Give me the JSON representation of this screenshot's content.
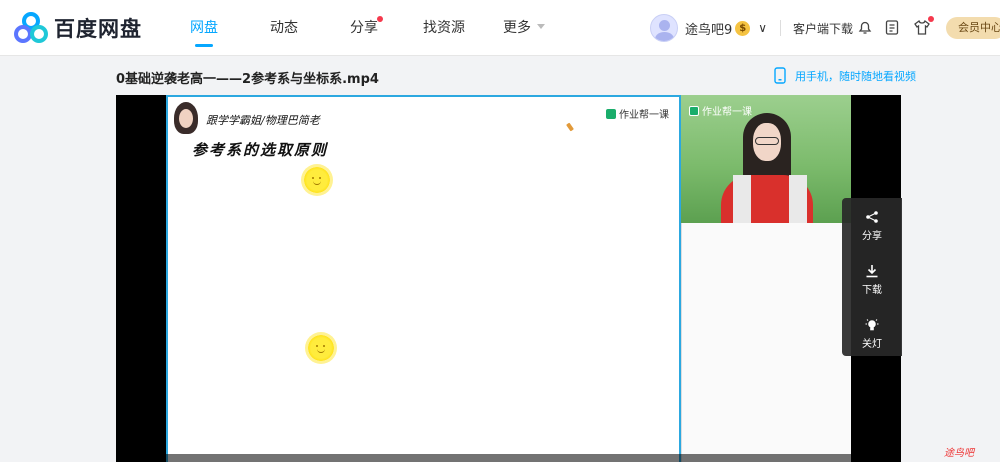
{
  "header": {
    "brand": "百度网盘",
    "nav": [
      {
        "label": "网盘",
        "active": true
      },
      {
        "label": "动态",
        "active": false
      },
      {
        "label": "分享",
        "active": false,
        "dot": true
      },
      {
        "label": "找资源",
        "active": false
      },
      {
        "label": "更多",
        "active": false,
        "caret": true
      }
    ],
    "username": "途鸟吧9",
    "vip_badge": "$",
    "client_download": "客户端下载",
    "member_center": "会员中心",
    "icons": [
      "bell-icon",
      "clipboard-icon",
      "tshirt-icon"
    ]
  },
  "video": {
    "title": "0基础逆袭老高一——2参考系与坐标系.mp4",
    "phone_link": "用手机，随时随地看视频",
    "board": {
      "teacher": "跟学学霸姐/物理巴简老",
      "logo": "作业帮一课",
      "heading": "参考系的选取原则"
    },
    "camera_logo": "作业帮一课"
  },
  "side_panel": [
    {
      "label": "分享",
      "icon": "share-icon"
    },
    {
      "label": "下载",
      "icon": "download-icon"
    },
    {
      "label": "关灯",
      "icon": "lightbulb-icon"
    }
  ],
  "watermark": "途鸟吧",
  "colors": {
    "accent": "#06a7ff",
    "board_border": "#2ca8e0",
    "member_bg": "#f3dcae"
  }
}
